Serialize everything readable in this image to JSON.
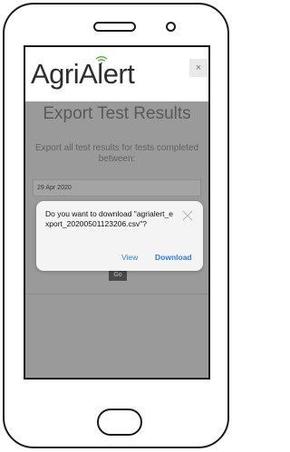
{
  "app": {
    "logo": "AgriAlert"
  },
  "header": {
    "close_glyph": "×"
  },
  "export": {
    "title": "Export Test Results",
    "subtitle": "Export all test results for tests completed between:",
    "date_value": "29 Apr 2020",
    "go_label": "Go"
  },
  "dialog": {
    "message": "Do you want to download \"agrialert_export_20200501123206.csv\"?",
    "view_label": "View",
    "download_label": "Download"
  },
  "colors": {
    "accent": "#2d7be0",
    "overlay_gray": "#9a9a9a",
    "logo_green": "#6ab04c"
  },
  "icons": [
    "wifi-signal-icon",
    "close-icon",
    "dialog-close-icon"
  ]
}
